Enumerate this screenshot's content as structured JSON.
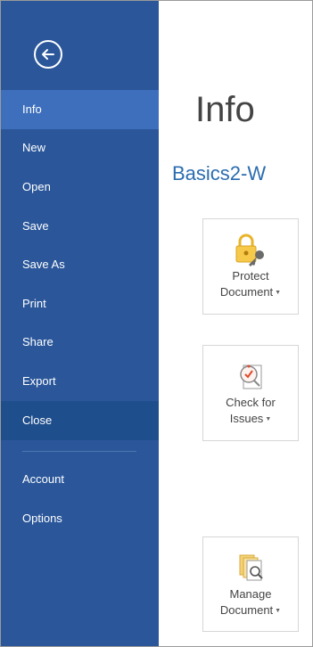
{
  "sidebar": {
    "back_icon": "back-arrow-icon",
    "items": [
      {
        "label": "Info",
        "state": "active"
      },
      {
        "label": "New"
      },
      {
        "label": "Open"
      },
      {
        "label": "Save"
      },
      {
        "label": "Save As"
      },
      {
        "label": "Print"
      },
      {
        "label": "Share"
      },
      {
        "label": "Export"
      },
      {
        "label": "Close",
        "state": "hover"
      },
      {
        "label": "Account"
      },
      {
        "label": "Options"
      }
    ]
  },
  "main": {
    "title": "Info",
    "document_name": "Basics2-W",
    "actions": [
      {
        "line1": "Protect",
        "line2": "Document",
        "icon": "lock-key-icon"
      },
      {
        "line1": "Check for",
        "line2": "Issues",
        "icon": "inspect-document-icon"
      },
      {
        "line1": "Manage",
        "line2": "Document",
        "icon": "manage-document-icon"
      }
    ]
  },
  "colors": {
    "sidebar": "#2b579a",
    "active_item": "#3e6fbc",
    "hover_item": "#1f4e8c",
    "document_name": "#2b6cb0",
    "title": "#444444"
  }
}
